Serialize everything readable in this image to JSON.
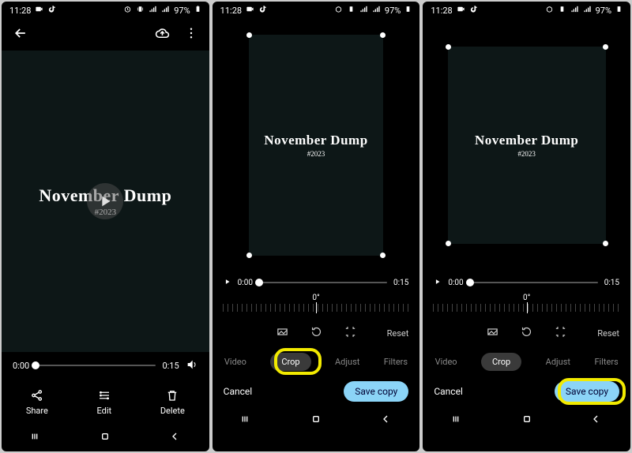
{
  "status": {
    "time": "11:28",
    "battery": "97%",
    "icons_left": [
      "camera-icon",
      "tiktok-icon"
    ],
    "icons_right": [
      "alarm-icon",
      "vibrate-icon",
      "signal-icon",
      "signal-icon",
      "battery-icon"
    ]
  },
  "screen1": {
    "video": {
      "title": "November Dump",
      "year": "#2023"
    },
    "timeline": {
      "current": "0:00",
      "total": "0:15"
    },
    "actions": {
      "share": "Share",
      "edit": "Edit",
      "delete": "Delete"
    }
  },
  "editor": {
    "video": {
      "title": "November Dump",
      "year": "#2023"
    },
    "timeline": {
      "current": "0:00",
      "total": "0:15"
    },
    "rotation": "0°",
    "reset": "Reset",
    "tabs": {
      "video": "Video",
      "crop": "Crop",
      "adjust": "Adjust",
      "filters": "Filters"
    },
    "cancel": "Cancel",
    "save": "Save copy"
  }
}
